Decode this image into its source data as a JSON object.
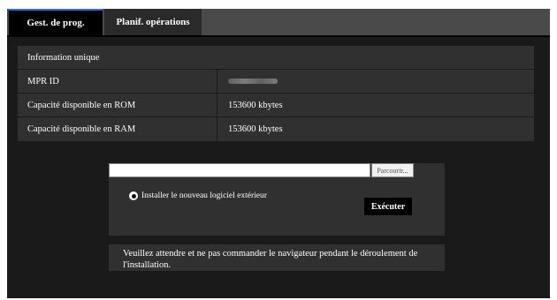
{
  "tabs": [
    {
      "label": "Gest. de prog.",
      "active": true
    },
    {
      "label": "Planif. opérations",
      "active": false
    }
  ],
  "info": {
    "header": "Information unique",
    "rows": [
      {
        "key": "MPR ID",
        "value": ""
      },
      {
        "key": "Capacité disponible en ROM",
        "value": "153600 kbytes"
      },
      {
        "key": "Capacité disponible en RAM",
        "value": "153600 kbytes"
      }
    ]
  },
  "upload": {
    "file_value": "",
    "browse_label": "Parcourir...",
    "radio_label": "Installer le nouveau logiciel extérieur",
    "radio_checked": true,
    "execute_label": "Exécuter"
  },
  "notice": "Veuillez attendre et ne pas commander le navigateur pendant le déroulement de l'installation.",
  "colors": {
    "background": "#1a1a1a",
    "panel": "#303030",
    "tabbar": "#4a4a4a",
    "active_tab_accent": "#2a6fd6"
  }
}
